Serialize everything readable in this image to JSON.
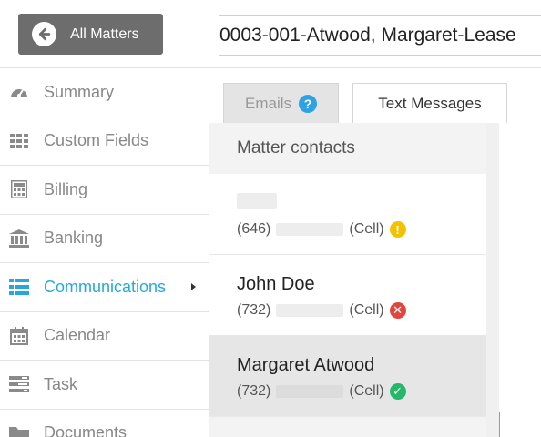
{
  "header": {
    "back_label": "All Matters",
    "matter_title": "0003-001-Atwood, Margaret-Lease"
  },
  "sidebar": {
    "items": [
      {
        "label": "Summary",
        "icon": "dashboard-icon"
      },
      {
        "label": "Custom Fields",
        "icon": "grid-icon"
      },
      {
        "label": "Billing",
        "icon": "calculator-icon"
      },
      {
        "label": "Banking",
        "icon": "bank-icon"
      },
      {
        "label": "Communications",
        "icon": "list-icon",
        "active": true
      },
      {
        "label": "Calendar",
        "icon": "calendar-icon"
      },
      {
        "label": "Task",
        "icon": "tasks-icon"
      },
      {
        "label": "Documents",
        "icon": "folder-icon"
      }
    ]
  },
  "tabs": {
    "emails": "Emails",
    "emails_help": "?",
    "text_messages": "Text Messages"
  },
  "panel": {
    "title": "Matter contacts",
    "contacts": [
      {
        "name": "",
        "area": "(646)",
        "type": "(Cell)",
        "status": "warning"
      },
      {
        "name": "John Doe",
        "area": "(732)",
        "type": "(Cell)",
        "status": "error"
      },
      {
        "name": "Margaret Atwood",
        "area": "(732)",
        "type": "(Cell)",
        "status": "success"
      }
    ]
  },
  "colors": {
    "accent": "#26a9d8",
    "back_button": "#6d6d6d",
    "warning": "#f2c200",
    "error": "#e0463c",
    "success": "#26b86a"
  }
}
